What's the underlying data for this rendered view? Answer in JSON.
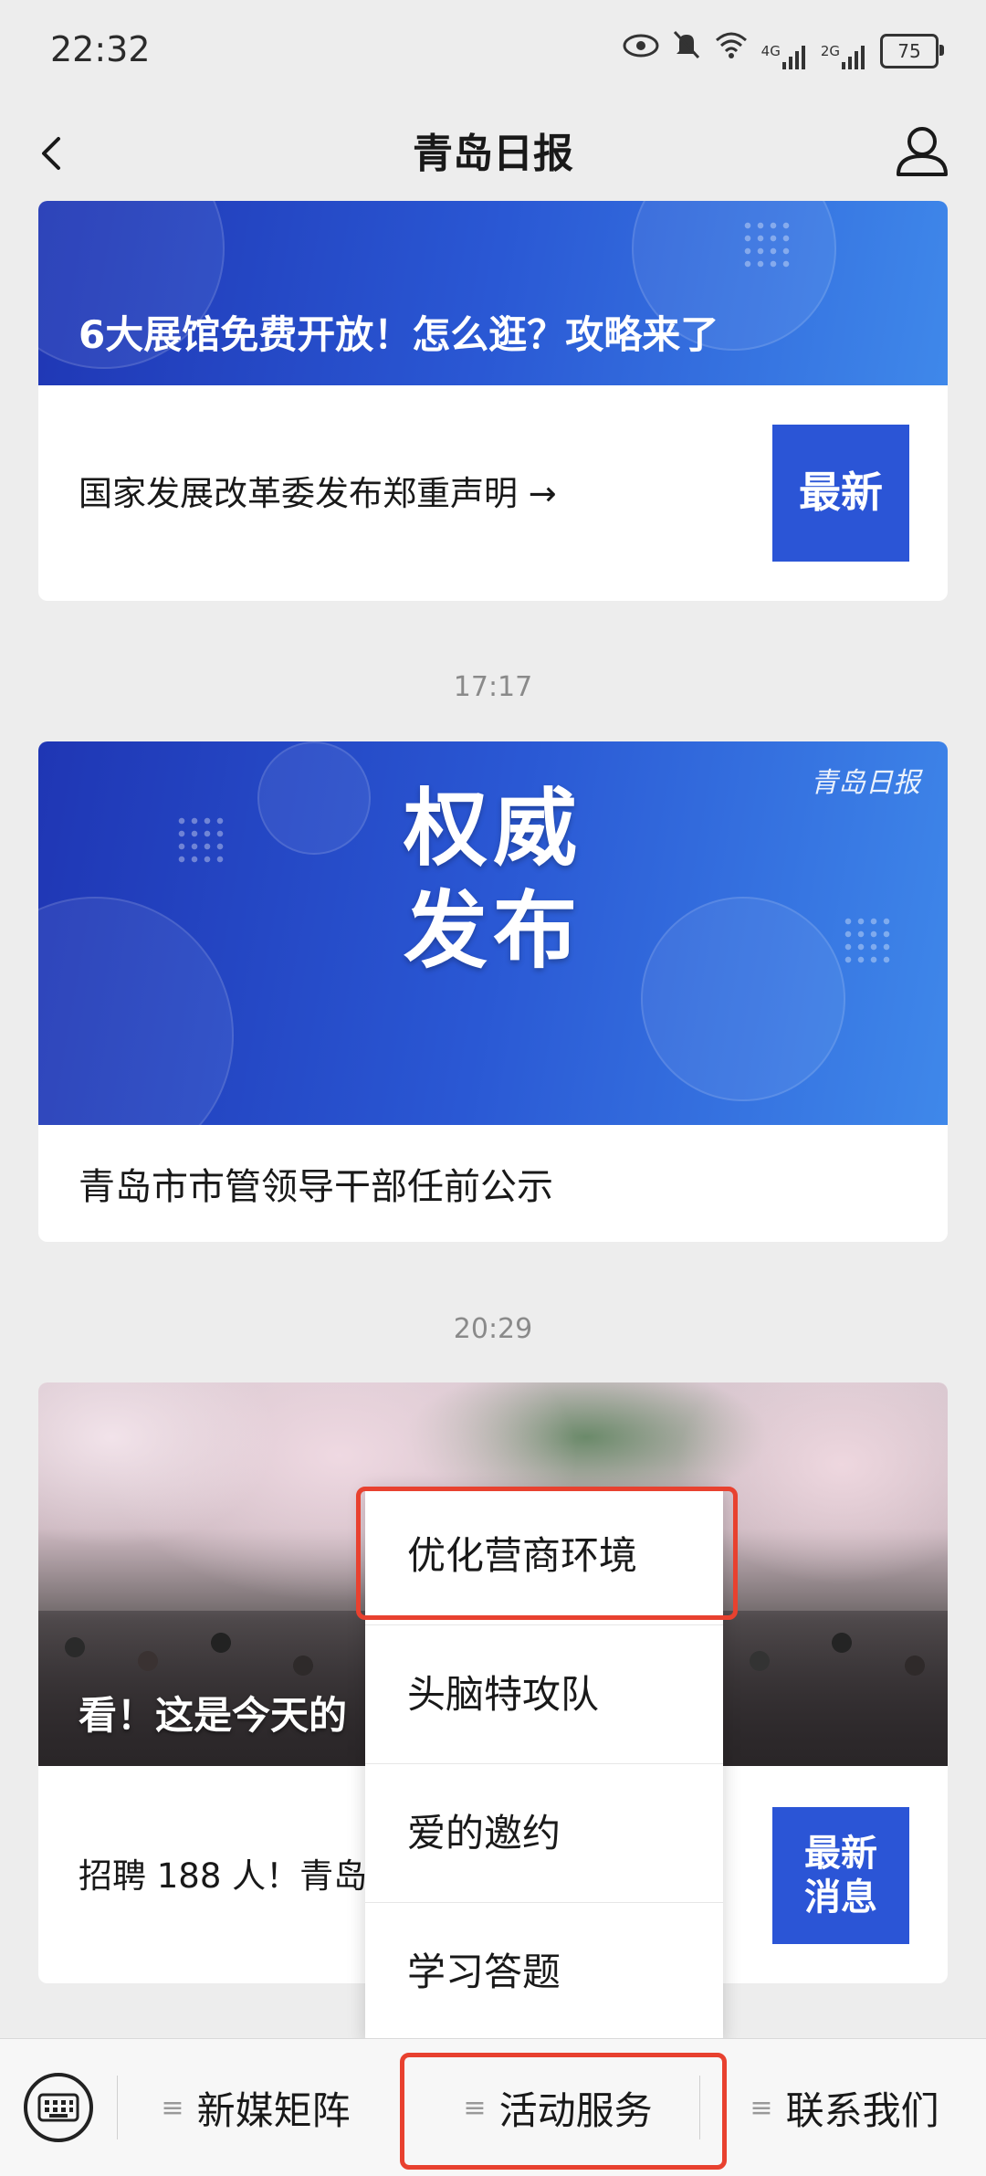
{
  "status_bar": {
    "time": "22:32",
    "network_1": "4G",
    "network_2": "2G",
    "battery": "75",
    "icons": [
      "eye-icon",
      "bell-muted-icon",
      "wifi-icon",
      "signal-icon",
      "signal-icon",
      "battery-icon"
    ]
  },
  "nav": {
    "title": "青岛日报",
    "back_icon": "chevron-left-icon",
    "profile_icon": "person-icon"
  },
  "messages": [
    {
      "banner_caption": "6大展馆免费开放！怎么逛？攻略来了",
      "link_text": "国家发展改革委发布郑重声明 →",
      "badge": "最新"
    },
    {
      "time": "17:17",
      "banner_title_line1": "权威",
      "banner_title_line2": "发布",
      "brand_logo": "青岛日报",
      "link_text": "青岛市市管领导干部任前公示"
    },
    {
      "time": "20:29",
      "banner_caption": "看！这是今天的",
      "link_text": "招聘 188 人！青岛",
      "badge_line1": "最新",
      "badge_line2": "消息"
    }
  ],
  "popup_menu": {
    "items": [
      "优化营商环境",
      "头脑特攻队",
      "爱的邀约",
      "学习答题"
    ],
    "highlighted_index": 0
  },
  "bottom_menu": {
    "keyboard_icon": "keyboard-icon",
    "tabs": [
      "新媒矩阵",
      "活动服务",
      "联系我们"
    ],
    "active_index": 1
  },
  "colors": {
    "accent_blue": "#2b55d6",
    "highlight_red": "#e8412f",
    "background": "#ededed"
  }
}
